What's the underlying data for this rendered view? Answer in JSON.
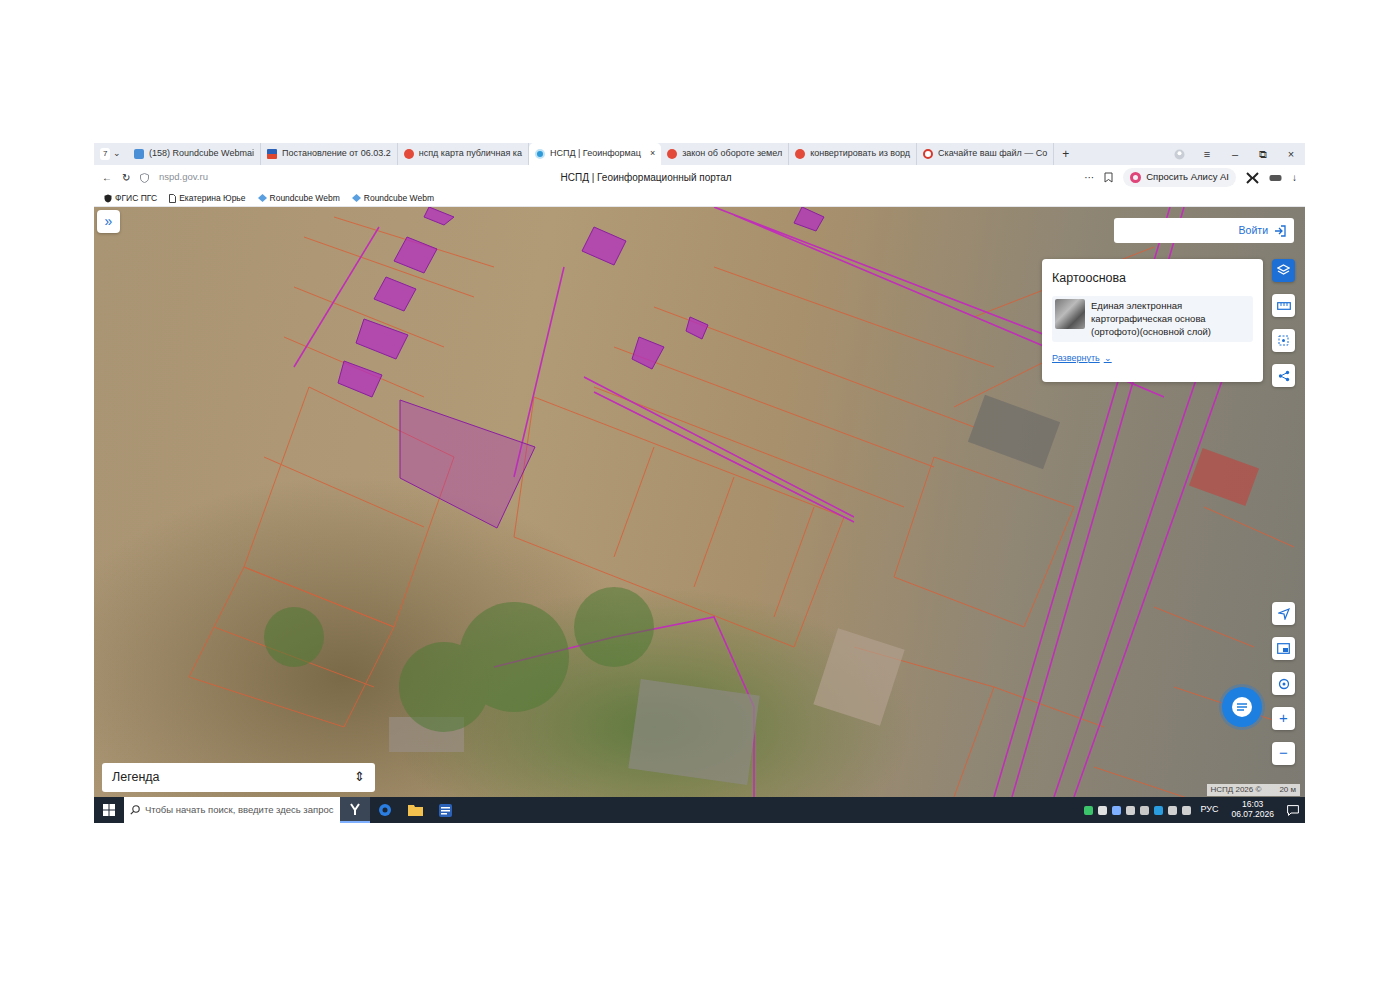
{
  "browser": {
    "tab_count": "7",
    "tab_menu": "⌄",
    "tabs": [
      {
        "label": "(158) Roundcube Webmai",
        "selected": false,
        "kind": "roundcube"
      },
      {
        "label": "Постановление от 06.03.2",
        "selected": false,
        "kind": "document"
      },
      {
        "label": "нспд карта публичная ка",
        "selected": false,
        "kind": "yandex"
      },
      {
        "label": "НСПД | Геоинформац",
        "selected": true,
        "kind": "nspd"
      },
      {
        "label": "закон об обороте земел",
        "selected": false,
        "kind": "yandex"
      },
      {
        "label": "конвертировать из ворд",
        "selected": false,
        "kind": "yandex"
      },
      {
        "label": "Скачайте ваш файл — Co",
        "selected": false,
        "kind": "download"
      }
    ],
    "close": "×",
    "new_tab": "+",
    "window_controls": [
      "≡",
      "–",
      "⧉",
      "×"
    ],
    "back": "←",
    "reload": "↻",
    "url": "nspd.gov.ru",
    "page_title": "НСПД | Геоинформационный портал",
    "more": "···",
    "alice": "Спросить Алису AI",
    "download": "↓",
    "bookmarks": [
      "ФГИС ПГС",
      "Екатерина Юрье",
      "Roundcube Webm",
      "Roundcube Webm"
    ]
  },
  "map": {
    "expand": "»",
    "login": "Войти",
    "basemap_panel": {
      "title": "Картооснова",
      "layer": "Единая электронная картографическая основа (ортофото)(основной слой)",
      "expand": "Развернуть",
      "expand_arrow": "⌄"
    },
    "zoom_in": "+",
    "zoom_out": "−",
    "legend": "Легенда",
    "legend_toggle": "⇕",
    "copyright": "НСПД 2026 ©",
    "scale": "20 м"
  },
  "taskbar": {
    "search_placeholder": "Чтобы начать поиск, введите здесь запрос",
    "language": "РУС",
    "time": "16:03",
    "date": "06.07.2026"
  }
}
